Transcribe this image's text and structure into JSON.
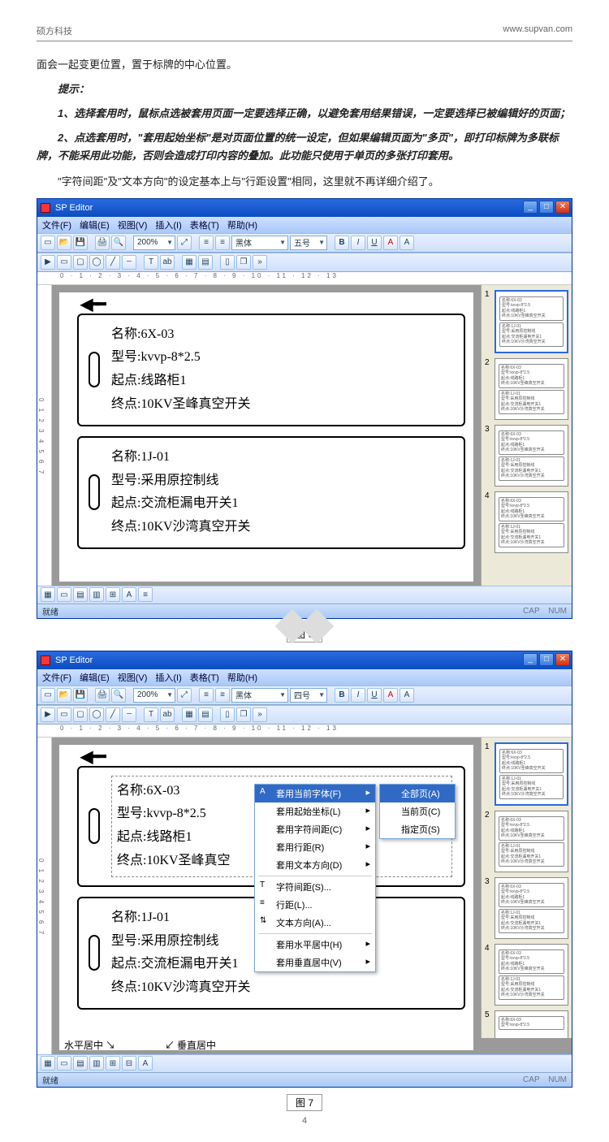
{
  "header": {
    "company": "硕方科技",
    "url": "www.supvan.com"
  },
  "doc": {
    "p1": "面会一起变更位置，置于标牌的中心位置。",
    "tip_label": "提示：",
    "tip1": "1、选择套用时，鼠标点选被套用页面一定要选择正确，以避免套用结果错误，一定要选择已被编辑好的页面；",
    "tip2": "2、点选套用时，\"套用起始坐标\"是对页面位置的统一设定，但如果编辑页面为\"多页\"，即打印标牌为多联标牌，不能采用此功能，否则会造成打印内容的叠加。此功能只使用于单页的多张打印套用。",
    "p2": "\"字符间距\"及\"文本方向\"的设定基本上与\"行距设置\"相同，这里就不再详细介绍了。",
    "fig6": "图 6",
    "fig7": "图 7",
    "pgnum": "4"
  },
  "app": {
    "title": "SP Editor",
    "menus": [
      "文件(F)",
      "编辑(E)",
      "视图(V)",
      "插入(I)",
      "表格(T)",
      "帮助(H)"
    ],
    "zoom": "200%",
    "font_name": "黑体",
    "font_size_a": "五号",
    "font_size_b": "四号",
    "status_left": "就绪",
    "status_right": [
      "CAP",
      "NUM"
    ],
    "card1": {
      "l1": "名称:6X-03",
      "l2": "型号:kvvp-8*2.5",
      "l3": "起点:线路柜1",
      "l4": "终点:10KV圣峰真空开关"
    },
    "card2": {
      "l1": "名称:1J-01",
      "l2": "型号:采用原控制线",
      "l3": "起点:交流柜漏电开关1",
      "l4": "终点:10KV沙湾真空开关"
    },
    "annot_h": "水平居中",
    "annot_v": "垂直居中",
    "ruler": "0 · 1 · 2 · 3 · 4 · 5 · 6 · 7 · 8 · 9 · 10 · 11 · 12 · 13",
    "thumbs": [
      "1",
      "2",
      "3",
      "4",
      "5"
    ],
    "ctx": {
      "items": [
        "套用当前字体(F)",
        "套用起始坐标(L)",
        "套用字符间距(C)",
        "套用行距(R)",
        "套用文本方向(D)",
        "字符间距(S)...",
        "行距(L)...",
        "文本方向(A)...",
        "套用水平居中(H)",
        "套用垂直居中(V)"
      ],
      "sub": [
        "全部页(A)",
        "当前页(C)",
        "指定页(S)"
      ]
    },
    "mini_text": [
      "名称:6X-03",
      "型号:kvvp-8*2.5",
      "起点:线路柜1",
      "终点:10KV圣峰真空开关",
      "名称:1J-01",
      "型号:采用原控制线",
      "起点:交流柜漏电开关1",
      "终点:10KV沙湾真空开关"
    ]
  }
}
